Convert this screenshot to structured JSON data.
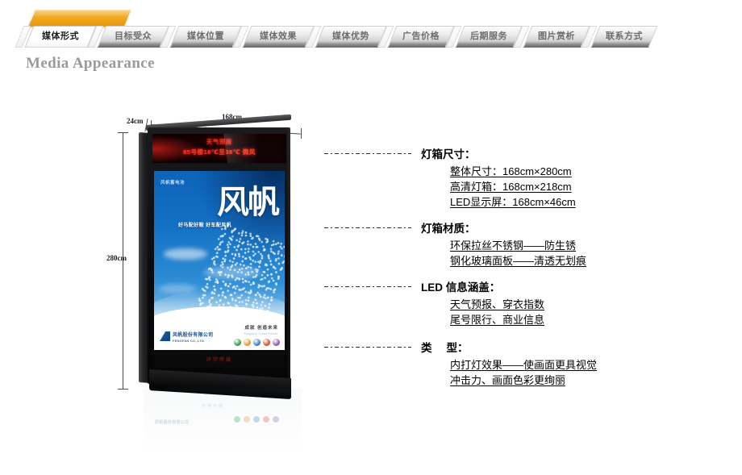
{
  "nav": {
    "tabs": [
      {
        "label": "媒体形式",
        "active": true
      },
      {
        "label": "目标受众",
        "active": false
      },
      {
        "label": "媒体位置",
        "active": false
      },
      {
        "label": "媒体效果",
        "active": false
      },
      {
        "label": "媒体优势",
        "active": false
      },
      {
        "label": "广告价格",
        "active": false
      },
      {
        "label": "后期服务",
        "active": false
      },
      {
        "label": "图片赏析",
        "active": false
      },
      {
        "label": "联系方式",
        "active": false
      }
    ]
  },
  "section_title": "Media Appearance",
  "dimensions": {
    "depth": "24cm",
    "width": "168cm",
    "height": "280cm"
  },
  "lightbox": {
    "led_line1": "天气预报",
    "led_line2": "85号楼18℃至38℃ 微风",
    "poster": {
      "brandline": "风帆蓄电池",
      "calligraphy": "风帆",
      "slogan": "好马配好鞍 好车配风帆",
      "logo_cn": "风帆股份有限公司",
      "logo_en": "FENGFAN CO.,LTD.",
      "tagline": "成就 创造未来",
      "tagline_en": "Flagship Creat Future",
      "icon_colors": [
        "#2f9a4e",
        "#e8932a",
        "#2f7fc4",
        "#d14b2a",
        "#8a56a8"
      ]
    },
    "bottom_band": "环宇传媒"
  },
  "specs": [
    {
      "title": "灯箱尺寸：",
      "items": [
        "整体尺寸：168cm×280cm",
        "高清灯箱：168cm×218cm",
        "LED显示屏：168cm×46cm"
      ]
    },
    {
      "title": "灯箱材质：",
      "items": [
        "环保拉丝不锈钢——防生锈",
        "钢化玻璃面板——清透无划痕"
      ]
    },
    {
      "title": "LED 信息涵盖：",
      "items": [
        "天气预报、穿衣指数",
        "尾号限行、商业信息"
      ]
    },
    {
      "title_prefix": "类",
      "title_suffix": "型：",
      "items": [
        "内打灯效果——使画面更具视觉",
        "冲击力、画面色彩更绚丽"
      ]
    }
  ],
  "colors": {
    "accent_orange": "#f0a81e",
    "poster_blue": "#1168bd",
    "led_red": "#ff3322",
    "heading_gray": "#9a9a9a"
  }
}
